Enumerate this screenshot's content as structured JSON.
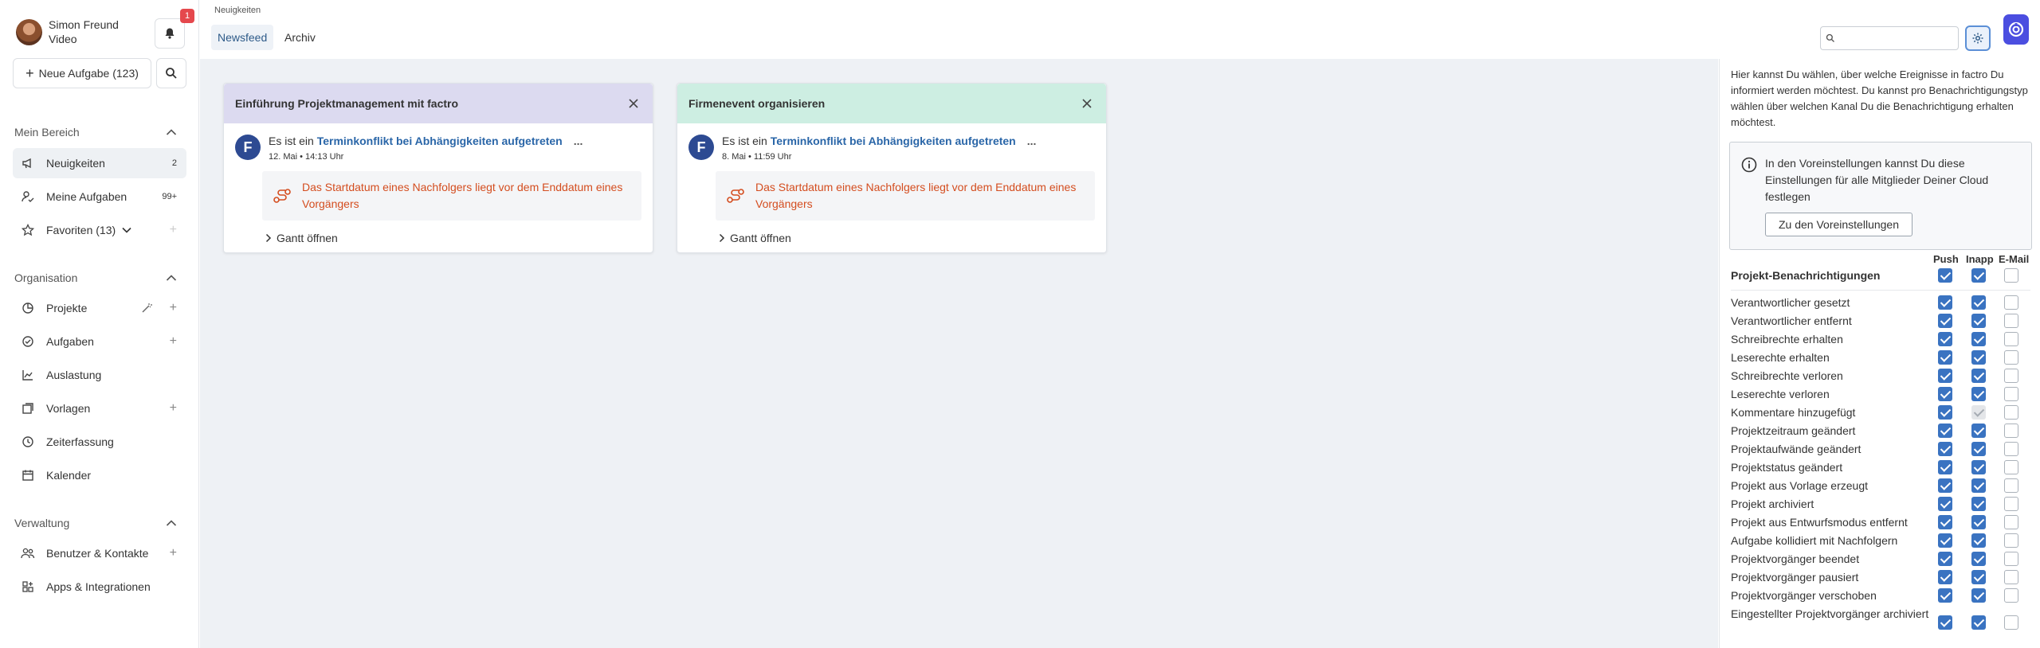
{
  "user": {
    "name": "Simon Freund",
    "subtitle": "Video",
    "notification_count": "1"
  },
  "sidebar": {
    "new_task_label": "Neue Aufgabe (123)",
    "sections": [
      {
        "title": "Mein Bereich",
        "items": [
          {
            "label": "Neuigkeiten",
            "count": "2",
            "icon": "megaphone-icon"
          },
          {
            "label": "Meine Aufgaben",
            "count": "99+",
            "icon": "user-check-icon"
          },
          {
            "label": "Favoriten (13)",
            "icon": "star-icon"
          }
        ]
      },
      {
        "title": "Organisation",
        "items": [
          {
            "label": "Projekte",
            "icon": "pie-chart-icon"
          },
          {
            "label": "Aufgaben",
            "icon": "check-circle-icon"
          },
          {
            "label": "Auslastung",
            "icon": "area-chart-icon"
          },
          {
            "label": "Vorlagen",
            "icon": "template-icon"
          },
          {
            "label": "Zeiterfassung",
            "icon": "clock-icon"
          },
          {
            "label": "Kalender",
            "icon": "calendar-icon"
          }
        ]
      },
      {
        "title": "Verwaltung",
        "items": [
          {
            "label": "Benutzer & Kontakte",
            "icon": "users-icon"
          },
          {
            "label": "Apps & Integrationen",
            "icon": "apps-icon"
          }
        ]
      }
    ]
  },
  "header": {
    "breadcrumb": "Neuigkeiten",
    "tabs": [
      "Newsfeed",
      "Archiv"
    ],
    "active_tab": "Newsfeed",
    "search_placeholder": ""
  },
  "feed": {
    "cards": [
      {
        "title": "Einführung Projektmanagement mit factro",
        "header_color": "#dcdaf0",
        "entry_prefix": "Es ist ein ",
        "entry_link": "Terminkonflikt bei Abhängigkeiten aufgetreten",
        "entry_more": "...",
        "date": "12. Mai • 14:13 Uhr",
        "warning": "Das Startdatum eines Nachfolgers liegt vor dem Enddatum eines Vorgängers",
        "action": "Gantt öffnen",
        "avatar_letter": "F"
      },
      {
        "title": "Firmenevent organisieren",
        "header_color": "#cdeee2",
        "entry_prefix": "Es ist ein ",
        "entry_link": "Terminkonflikt bei Abhängigkeiten aufgetreten",
        "entry_more": "...",
        "date": "8. Mai • 11:59 Uhr",
        "warning": "Das Startdatum eines Nachfolgers liegt vor dem Enddatum eines Vorgängers",
        "action": "Gantt öffnen",
        "avatar_letter": "F"
      }
    ]
  },
  "settings": {
    "intro": "Hier kannst Du wählen, über welche Ereignisse in factro Du informiert werden möchtest. Du kannst pro Benachrichtigungstyp wählen über welchen Kanal Du die Benachrichtigung erhalten möchtest.",
    "info_text": "In den Voreinstellungen kannst Du diese Einstellungen für alle Mitglieder Deiner Cloud festlegen",
    "info_button": "Zu den Voreinstellungen",
    "columns": [
      "Push",
      "Inapp",
      "E-Mail"
    ],
    "group": {
      "label": "Projekt-Benachrichtigungen",
      "push": true,
      "inapp": true,
      "email": false
    },
    "rows": [
      {
        "label": "Verantwortlicher gesetzt",
        "push": true,
        "inapp": true,
        "email": false
      },
      {
        "label": "Verantwortlicher entfernt",
        "push": true,
        "inapp": true,
        "email": false
      },
      {
        "label": "Schreibrechte erhalten",
        "push": true,
        "inapp": true,
        "email": false
      },
      {
        "label": "Leserechte erhalten",
        "push": true,
        "inapp": true,
        "email": false
      },
      {
        "label": "Schreibrechte verloren",
        "push": true,
        "inapp": true,
        "email": false
      },
      {
        "label": "Leserechte verloren",
        "push": true,
        "inapp": true,
        "email": false
      },
      {
        "label": "Kommentare hinzugefügt",
        "push": true,
        "inapp": "disabled",
        "email": false
      },
      {
        "label": "Projektzeitraum geändert",
        "push": true,
        "inapp": true,
        "email": false
      },
      {
        "label": "Projektaufwände geändert",
        "push": true,
        "inapp": true,
        "email": false
      },
      {
        "label": "Projektstatus geändert",
        "push": true,
        "inapp": true,
        "email": false
      },
      {
        "label": "Projekt aus Vorlage erzeugt",
        "push": true,
        "inapp": true,
        "email": false
      },
      {
        "label": "Projekt archiviert",
        "push": true,
        "inapp": true,
        "email": false
      },
      {
        "label": "Projekt aus Entwurfsmodus entfernt",
        "push": true,
        "inapp": true,
        "email": false
      },
      {
        "label": "Aufgabe kollidiert mit Nachfolgern",
        "push": true,
        "inapp": true,
        "email": false
      },
      {
        "label": "Projektvorgänger beendet",
        "push": true,
        "inapp": true,
        "email": false
      },
      {
        "label": "Projektvorgänger pausiert",
        "push": true,
        "inapp": true,
        "email": false
      },
      {
        "label": "Projektvorgänger verschoben",
        "push": true,
        "inapp": true,
        "email": false
      },
      {
        "label": "Eingestellter Projektvorgänger archiviert",
        "push": true,
        "inapp": true,
        "email": false
      }
    ]
  },
  "colors": {
    "accent": "#3a73c1",
    "warning": "#d44d1f",
    "link": "#2a66a8",
    "logo": "#4b4ee0"
  }
}
